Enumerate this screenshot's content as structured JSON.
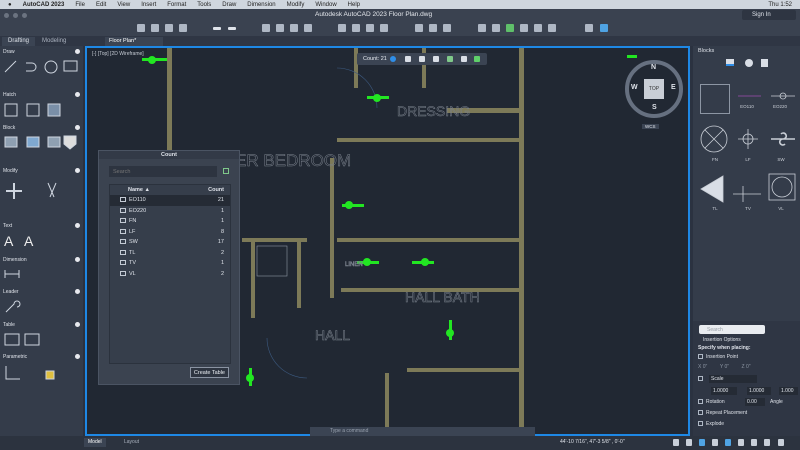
{
  "macbar": {
    "app": "AutoCAD 2023",
    "menus": [
      "File",
      "Edit",
      "View",
      "Insert",
      "Format",
      "Tools",
      "Draw",
      "Dimension",
      "Modify",
      "Window",
      "Help"
    ],
    "clock": "Thu 1:52"
  },
  "window": {
    "title": "Autodesk AutoCAD 2023   Floor Plan.dwg",
    "sign_in": "Sign In"
  },
  "palette_tabs": [
    "Drafting",
    "Modeling"
  ],
  "file_tab": "Floor Plan*",
  "left_palette": {
    "sections": [
      "Draw",
      "Hatch",
      "Block",
      "Modify",
      "Text",
      "Dimension",
      "Leader",
      "Table",
      "Parametric"
    ]
  },
  "viewport": {
    "label": "[-] [Top] [2D Wireframe]",
    "count_toolbar": {
      "label": "Count:  21"
    },
    "viewcube": {
      "top": "TOP",
      "n": "N",
      "s": "S",
      "e": "E",
      "w": "W",
      "wcs": "WCS"
    },
    "rooms": [
      "ER BEDROOM",
      "DRESSING",
      "HALL BATH",
      "HALL",
      "LINEN"
    ]
  },
  "count_palette": {
    "title": "Count",
    "search_placeholder": "Search",
    "col_name": "Name ▲",
    "col_count": "Count",
    "rows": [
      {
        "name": "EO110",
        "count": "21"
      },
      {
        "name": "EO220",
        "count": "1"
      },
      {
        "name": "FN",
        "count": "1"
      },
      {
        "name": "LF",
        "count": "8"
      },
      {
        "name": "SW",
        "count": "17"
      },
      {
        "name": "TL",
        "count": "2"
      },
      {
        "name": "TV",
        "count": "1"
      },
      {
        "name": "VL",
        "count": "2"
      }
    ],
    "create_table": "Create Table"
  },
  "blocks_palette": {
    "title": "Blocks",
    "items": [
      "",
      "EO110",
      "EO220",
      "FN",
      "LF",
      "SW",
      "TL",
      "TV",
      "VL"
    ],
    "search_placeholder": "Search",
    "insertion": {
      "header": "Insertion Options",
      "specify": "Specify when placing:",
      "insertion_point": "Insertion Point",
      "x": "X",
      "y": "Y",
      "z": "Z",
      "xv": "0\"",
      "yv": "0\"",
      "zv": "0\"",
      "scale": "Scale",
      "sx": "1.0000",
      "sy": "1.0000",
      "sz": "1.000",
      "rotation": "Rotation",
      "rot_value": "0.00",
      "angle": "Angle",
      "repeat": "Repeat Placement",
      "explode": "Explode"
    }
  },
  "status": {
    "model": "Model",
    "layout": "Layout",
    "command_placeholder": "Type a command",
    "coords": "44'-10 7/16\", 47'-3 5/8\" , 0'-0\""
  },
  "colors": {
    "accent": "#1e88e5",
    "walls": "#7d7a58",
    "count_highlight": "#22e622"
  }
}
